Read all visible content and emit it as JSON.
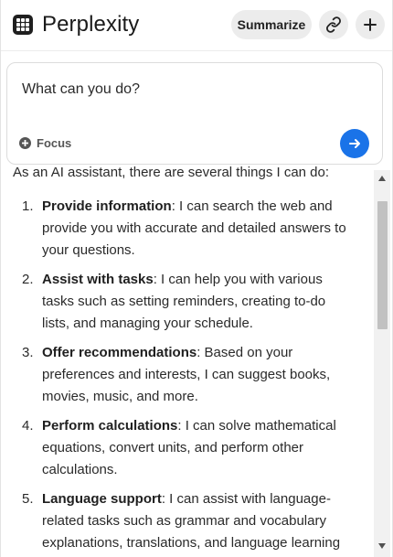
{
  "header": {
    "brand": "Perplexity",
    "summarize_label": "Summarize"
  },
  "ask": {
    "query": "What can you do?",
    "focus_label": "Focus"
  },
  "answer": {
    "intro": "As an AI assistant, there are several things I can do:",
    "items": [
      {
        "num": "1.",
        "title": "Provide information",
        "text": ": I can search the web and provide you with accurate and detailed answers to your questions."
      },
      {
        "num": "2.",
        "title": "Assist with tasks",
        "text": ": I can help you with various tasks such as setting reminders, creating to-do lists, and managing your schedule."
      },
      {
        "num": "3.",
        "title": "Offer recommendations",
        "text": ": Based on your preferences and interests, I can suggest books, movies, music, and more."
      },
      {
        "num": "4.",
        "title": "Perform calculations",
        "text": ": I can solve mathematical equations, convert units, and perform other calculations."
      },
      {
        "num": "5.",
        "title": "Language support",
        "text": ": I can assist with language-related tasks such as grammar and vocabulary explanations, translations, and language learning"
      }
    ]
  },
  "colors": {
    "submit": "#1a73e8",
    "pill": "#ececec"
  },
  "icons": [
    "grid-logo-icon",
    "link-icon",
    "plus-icon",
    "focus-plus-icon",
    "arrow-right-icon"
  ]
}
